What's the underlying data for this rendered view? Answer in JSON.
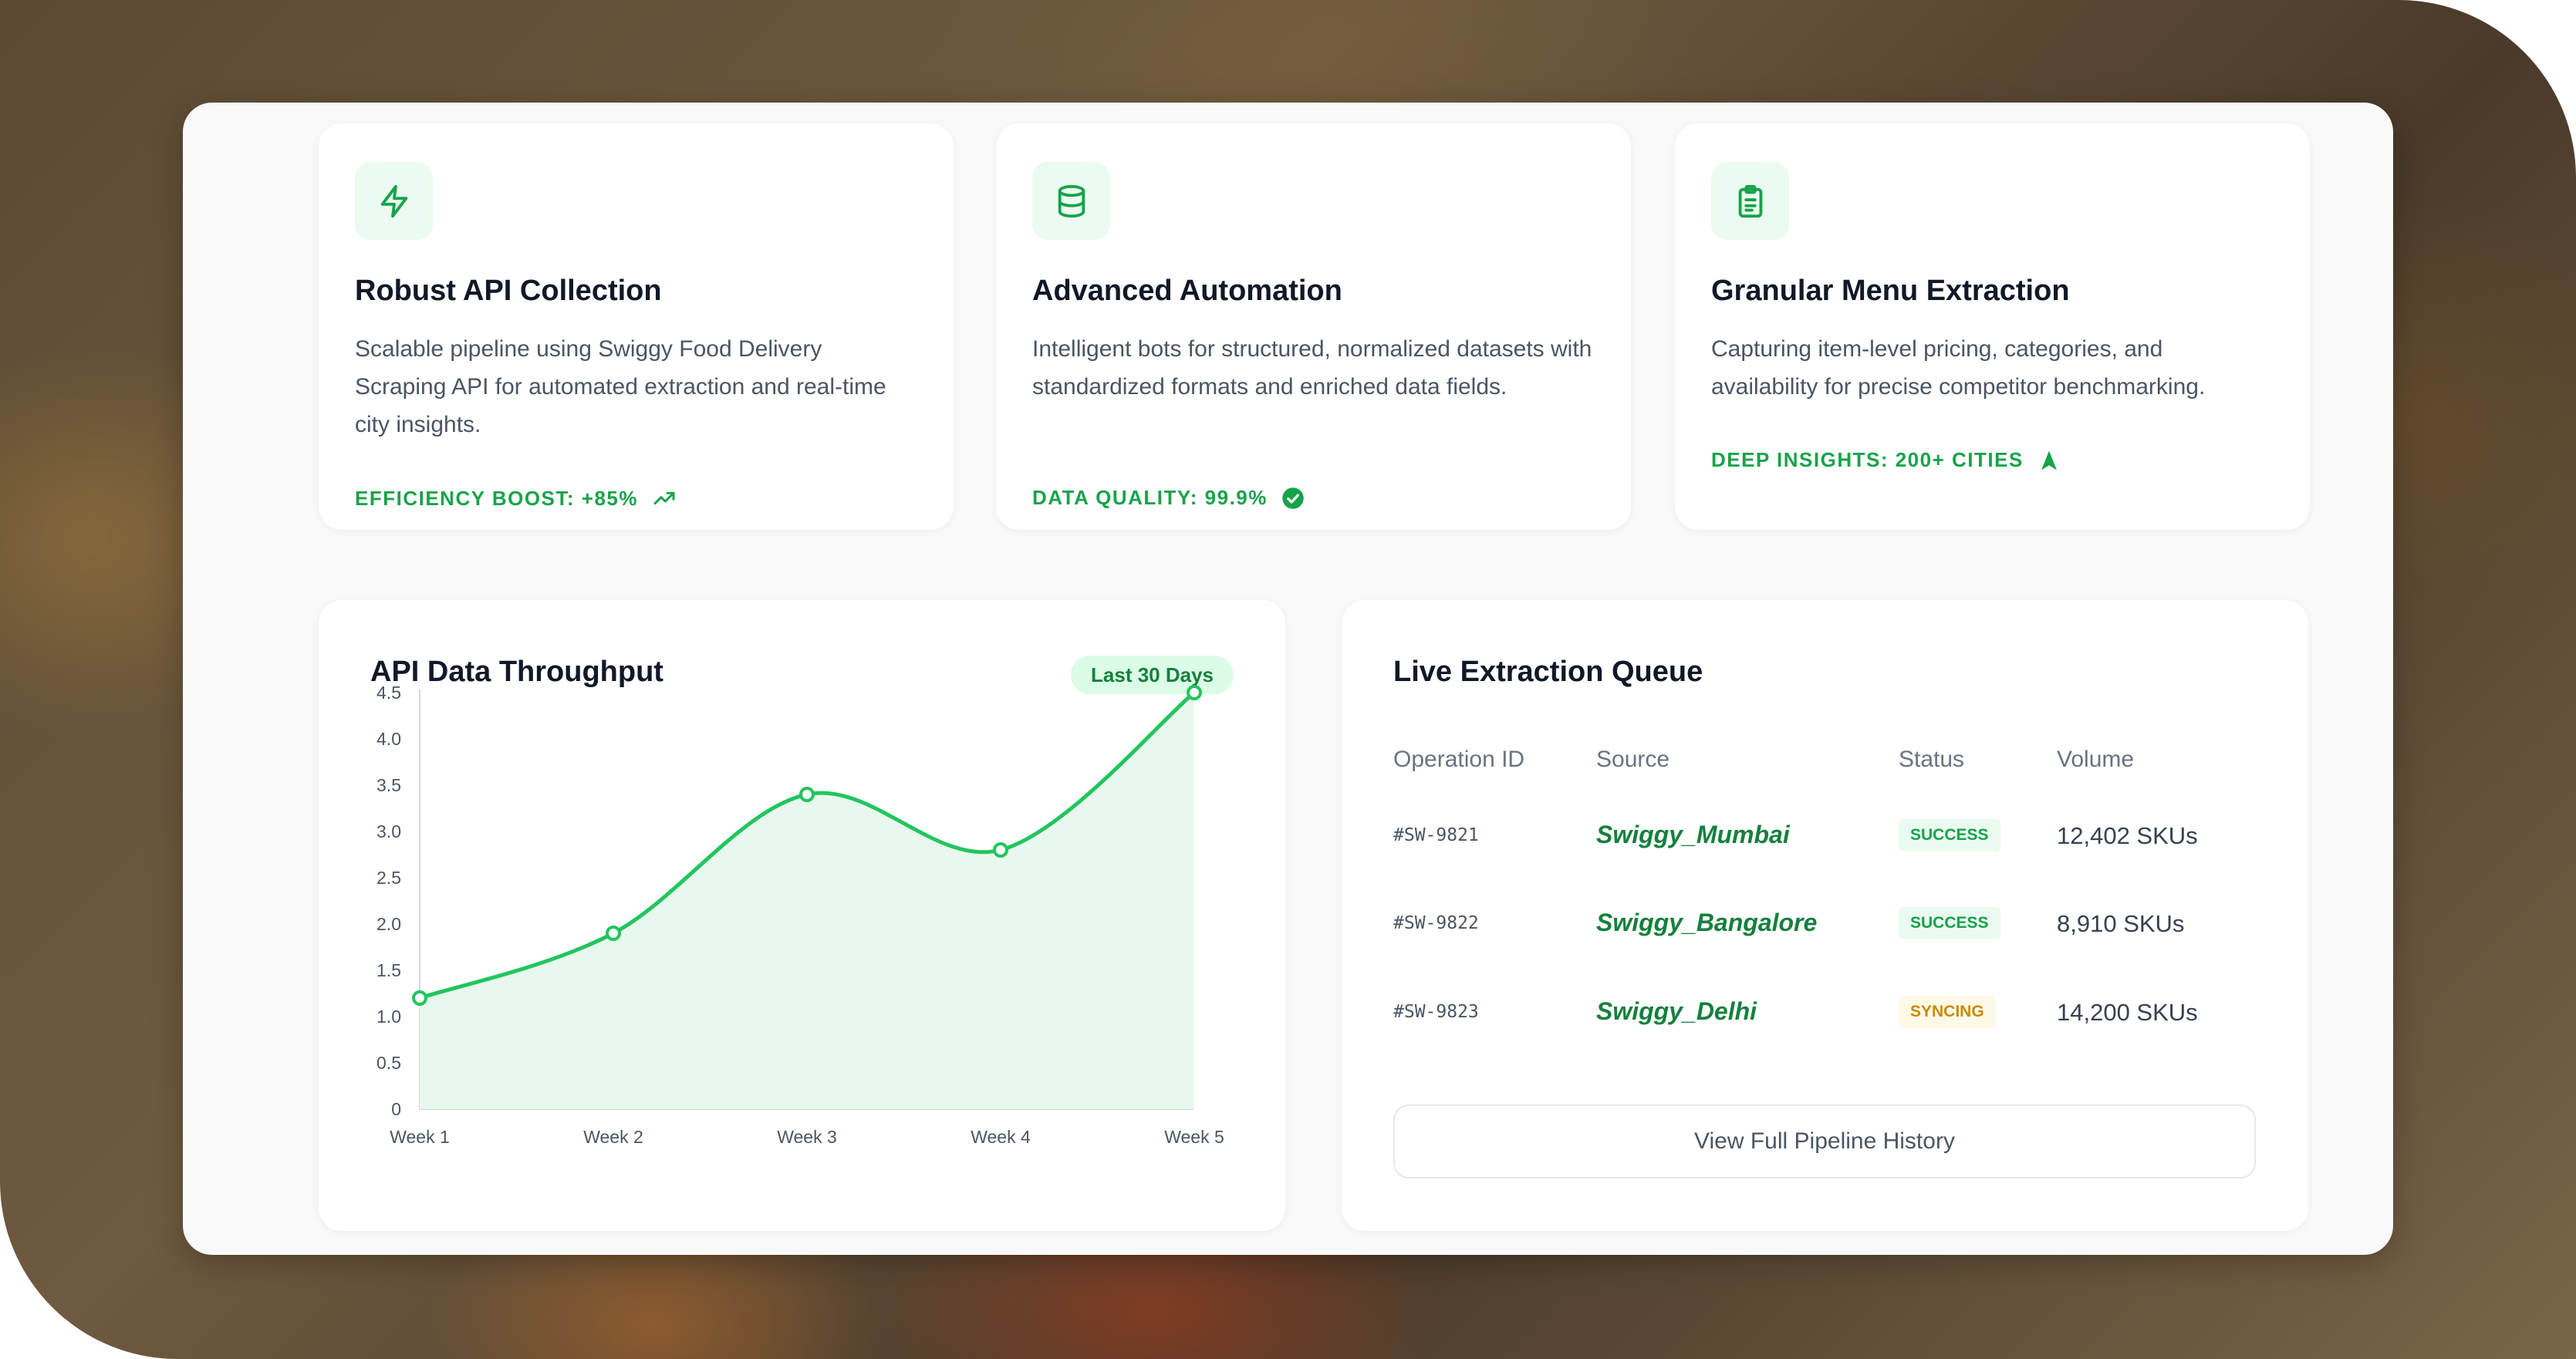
{
  "features": [
    {
      "icon": "lightning-icon",
      "title": "Robust API Collection",
      "description": "Scalable pipeline using Swiggy Food Delivery Scraping API for automated extraction and real-time city insights.",
      "stat": "EFFICIENCY BOOST: +85%",
      "stat_icon": "trending-up-icon"
    },
    {
      "icon": "database-icon",
      "title": "Advanced Automation",
      "description": "Intelligent bots for structured, normalized datasets with standardized formats and enriched data fields.",
      "stat": "DATA QUALITY: 99.9%",
      "stat_icon": "check-circle-icon"
    },
    {
      "icon": "clipboard-icon",
      "title": "Granular Menu Extraction",
      "description": "Capturing item-level pricing, categories, and availability for precise competitor benchmarking.",
      "stat": "DEEP INSIGHTS: 200+ CITIES",
      "stat_icon": "navigation-icon"
    }
  ],
  "throughput": {
    "title": "API Data Throughput",
    "range_badge": "Last 30 Days"
  },
  "chart_data": {
    "type": "area",
    "title": "API Data Throughput",
    "categories": [
      "Week 1",
      "Week 2",
      "Week 3",
      "Week 4",
      "Week 5"
    ],
    "values": [
      1.2,
      1.9,
      3.4,
      2.8,
      4.5
    ],
    "ylim": [
      0,
      4.5
    ],
    "yticks": [
      "0",
      "0.5",
      "1.0",
      "1.5",
      "2.0",
      "2.5",
      "3.0",
      "3.5",
      "4.0",
      "4.5"
    ],
    "xlabel": "",
    "ylabel": "",
    "grid": false,
    "line_color": "#22c55e",
    "fill_color": "#e8f8ee"
  },
  "queue": {
    "title": "Live Extraction Queue",
    "headers": [
      "Operation ID",
      "Source",
      "Status",
      "Volume"
    ],
    "rows": [
      {
        "id": "#SW-9821",
        "source": "Swiggy_Mumbai",
        "status": "SUCCESS",
        "volume": "12,402 SKUs"
      },
      {
        "id": "#SW-9822",
        "source": "Swiggy_Bangalore",
        "status": "SUCCESS",
        "volume": "8,910 SKUs"
      },
      {
        "id": "#SW-9823",
        "source": "Swiggy_Delhi",
        "status": "SYNCING",
        "volume": "14,200 SKUs"
      }
    ],
    "history_button": "View Full Pipeline History"
  },
  "colors": {
    "accent": "#16a34a",
    "success": "#16a34a",
    "syncing": "#ca8a04"
  }
}
